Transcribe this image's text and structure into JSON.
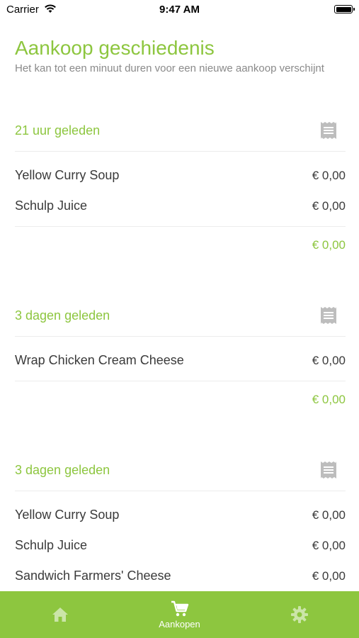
{
  "status_bar": {
    "carrier": "Carrier",
    "time": "9:47 AM"
  },
  "header": {
    "title": "Aankoop geschiedenis",
    "subtitle": "Het kan tot een minuut duren voor een nieuwe aankoop verschijnt"
  },
  "groups": [
    {
      "when": "21 uur geleden",
      "receipt_icon": "receipt-icon",
      "items": [
        {
          "name": "Yellow Curry Soup",
          "price": "€ 0,00"
        },
        {
          "name": "Schulp Juice",
          "price": "€ 0,00"
        }
      ],
      "total": "€ 0,00"
    },
    {
      "when": "3 dagen geleden",
      "receipt_icon": "receipt-icon",
      "items": [
        {
          "name": "Wrap Chicken Cream Cheese",
          "price": "€ 0,00"
        }
      ],
      "total": "€ 0,00"
    },
    {
      "when": "3 dagen geleden",
      "receipt_icon": "receipt-icon",
      "items": [
        {
          "name": "Yellow Curry Soup",
          "price": "€ 0,00"
        },
        {
          "name": "Schulp Juice",
          "price": "€ 0,00"
        },
        {
          "name": "Sandwich Farmers' Cheese",
          "price": "€ 0,00"
        }
      ],
      "total": ""
    }
  ],
  "tabbar": {
    "home_icon": "home-icon",
    "cart_icon": "cart-icon",
    "cart_label": "Aankopen",
    "settings_icon": "gear-icon",
    "active": "cart"
  },
  "colors": {
    "accent": "#8dc63f",
    "text": "#3a3a3a",
    "subtle": "#8a8a8a"
  }
}
